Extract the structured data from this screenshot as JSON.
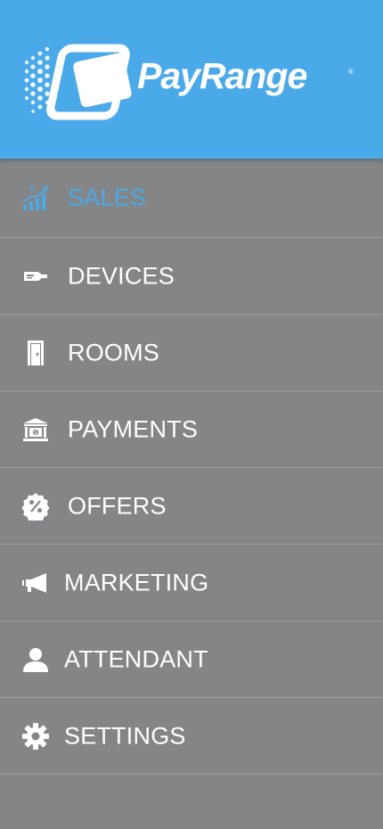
{
  "brand": {
    "name": "PayRange",
    "registered_mark": "®",
    "color": "#4aa9e9"
  },
  "colors": {
    "header_bg": "#4aa9e9",
    "menu_bg": "#848587",
    "divider": "#9c9da0",
    "active_text": "#4aa9e9",
    "text": "#ffffff"
  },
  "menu": {
    "items": [
      {
        "label": "SALES",
        "icon": "sales-chart-icon",
        "active": true
      },
      {
        "label": "DEVICES",
        "icon": "device-icon",
        "active": false
      },
      {
        "label": "ROOMS",
        "icon": "door-icon",
        "active": false
      },
      {
        "label": "PAYMENTS",
        "icon": "bank-icon",
        "active": false
      },
      {
        "label": "OFFERS",
        "icon": "percent-badge-icon",
        "active": false
      },
      {
        "label": "MARKETING",
        "icon": "megaphone-icon",
        "active": false
      },
      {
        "label": "ATTENDANT",
        "icon": "user-icon",
        "active": false
      },
      {
        "label": "SETTINGS",
        "icon": "gear-icon",
        "active": false
      }
    ]
  }
}
